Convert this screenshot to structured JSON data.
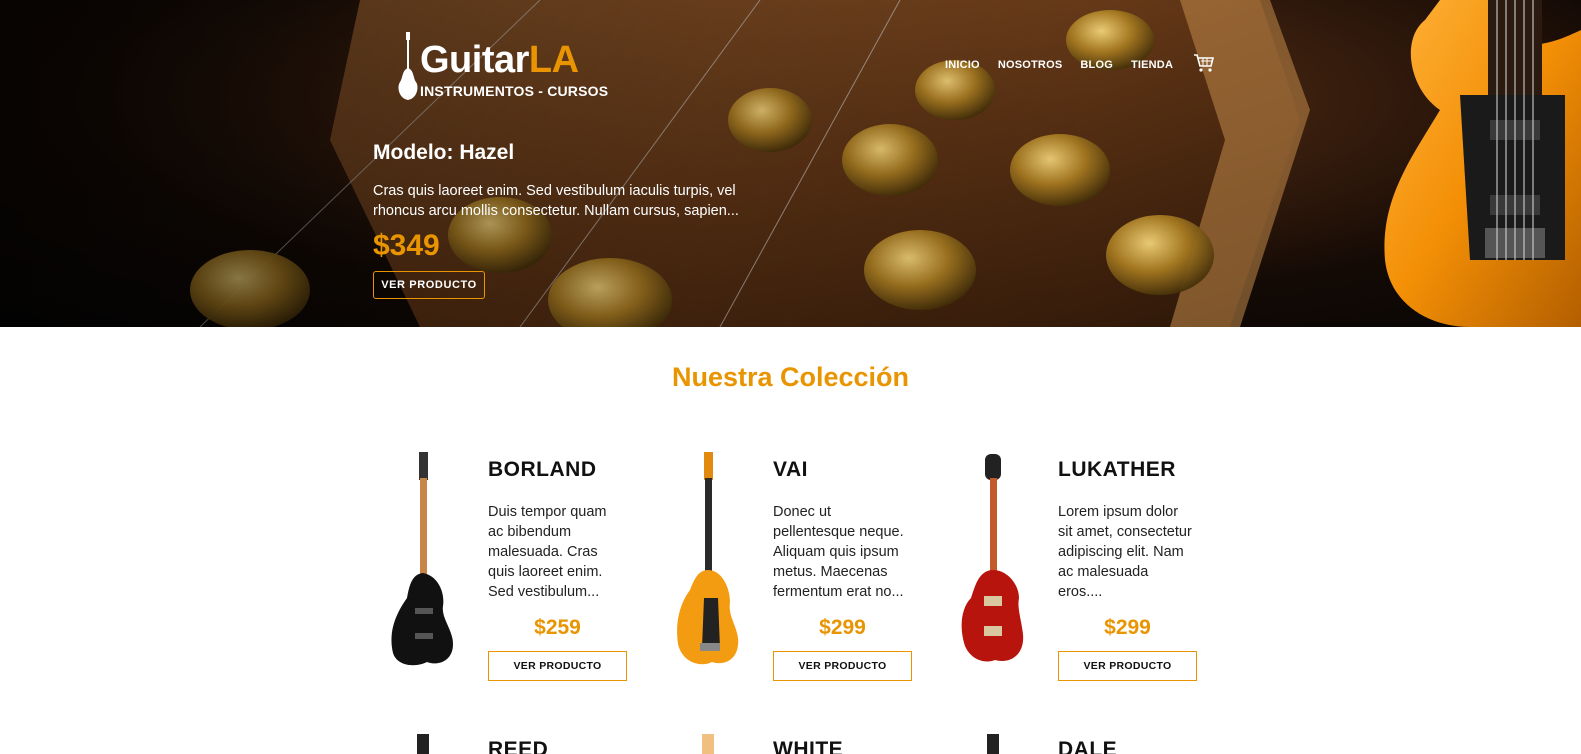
{
  "logo": {
    "word_main": "Guitar",
    "word_accent": "LA",
    "tagline": "INSTRUMENTOS - CURSOS"
  },
  "nav": {
    "items": [
      "INICIO",
      "NOSOTROS",
      "BLOG",
      "TIENDA"
    ],
    "cart_icon": "cart-icon"
  },
  "hero": {
    "title": "Modelo: Hazel",
    "description": "Cras quis laoreet enim. Sed vestibulum iaculis turpis, vel rhoncus arcu mollis consectetur. Nullam cursus, sapien...",
    "price": "$349",
    "button": "VER PRODUCTO"
  },
  "collection": {
    "title": "Nuestra Colección",
    "products": [
      {
        "name": "BORLAND",
        "description": "Duis tempor quam ac bibendum malesuada. Cras quis laoreet enim. Sed vestibulum...",
        "price": "$259",
        "button": "VER PRODUCTO",
        "guitar_color": "#111111"
      },
      {
        "name": "VAI",
        "description": "Donec ut pellentesque neque. Aliquam quis ipsum metus. Maecenas fermentum erat no...",
        "price": "$299",
        "button": "VER PRODUCTO",
        "guitar_color": "#f39c12"
      },
      {
        "name": "LUKATHER",
        "description": "Lorem ipsum dolor sit amet, consectetur adipiscing elit. Nam ac malesuada eros....",
        "price": "$299",
        "button": "VER PRODUCTO",
        "guitar_color": "#b8140e"
      }
    ],
    "next_row": [
      "REED",
      "WHITE",
      "DALE"
    ]
  },
  "colors": {
    "accent": "#e99401",
    "text": "#111111",
    "background": "#ffffff"
  }
}
